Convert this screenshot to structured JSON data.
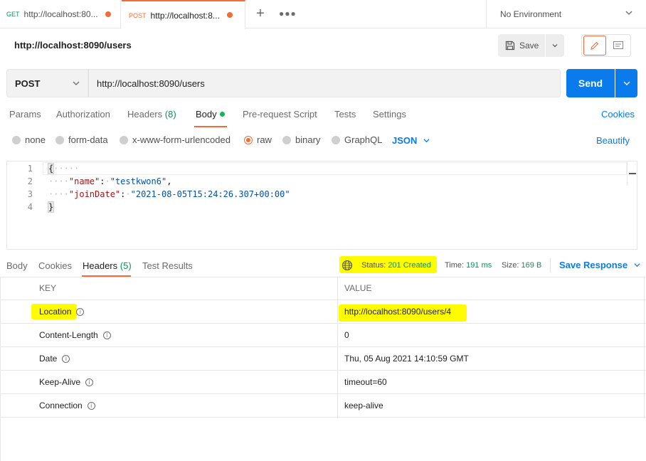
{
  "tabs": [
    {
      "method": "GET",
      "url": "http://localhost:80..."
    },
    {
      "method": "POST",
      "url": "http://localhost:8..."
    }
  ],
  "environment": {
    "label": "No Environment"
  },
  "request": {
    "title": "http://localhost:8090/users",
    "save_label": "Save",
    "method": "POST",
    "url": "http://localhost:8090/users",
    "send_label": "Send"
  },
  "request_tabs": {
    "params": "Params",
    "authorization": "Authorization",
    "headers": "Headers",
    "headers_count": "(8)",
    "body": "Body",
    "prerequest": "Pre-request Script",
    "tests": "Tests",
    "settings": "Settings",
    "cookies": "Cookies"
  },
  "body_types": {
    "none": "none",
    "form_data": "form-data",
    "urlencoded": "x-www-form-urlencoded",
    "raw": "raw",
    "binary": "binary",
    "graphql": "GraphQL",
    "format": "JSON",
    "beautify": "Beautify"
  },
  "editor": {
    "line_numbers": [
      "1",
      "2",
      "3",
      "4"
    ],
    "open_brace": "{",
    "close_brace": "}",
    "key1": "\"name\"",
    "val1": "\"testkwon6\"",
    "key2": "\"joinDate\"",
    "val2": "\"2021-08-05T15:24:26.307+00:00\""
  },
  "response": {
    "tabs": {
      "body": "Body",
      "cookies": "Cookies",
      "headers": "Headers",
      "headers_count": "(5)",
      "test_results": "Test Results"
    },
    "status_label": "Status:",
    "status_value": "201 Created",
    "time_label": "Time:",
    "time_value": "191 ms",
    "size_label": "Size:",
    "size_value": "169 B",
    "save_response": "Save Response",
    "table_header": {
      "key": "KEY",
      "value": "VALUE"
    },
    "headers": [
      {
        "key": "Location",
        "value": "http://localhost:8090/users/4"
      },
      {
        "key": "Content-Length",
        "value": "0"
      },
      {
        "key": "Date",
        "value": "Thu, 05 Aug 2021 14:10:59 GMT"
      },
      {
        "key": "Keep-Alive",
        "value": "timeout=60"
      },
      {
        "key": "Connection",
        "value": "keep-alive"
      }
    ]
  },
  "colors": {
    "accent": "#f26b3a",
    "send": "#097bed",
    "success": "#0f8f5d",
    "highlight": "#fffb00"
  }
}
